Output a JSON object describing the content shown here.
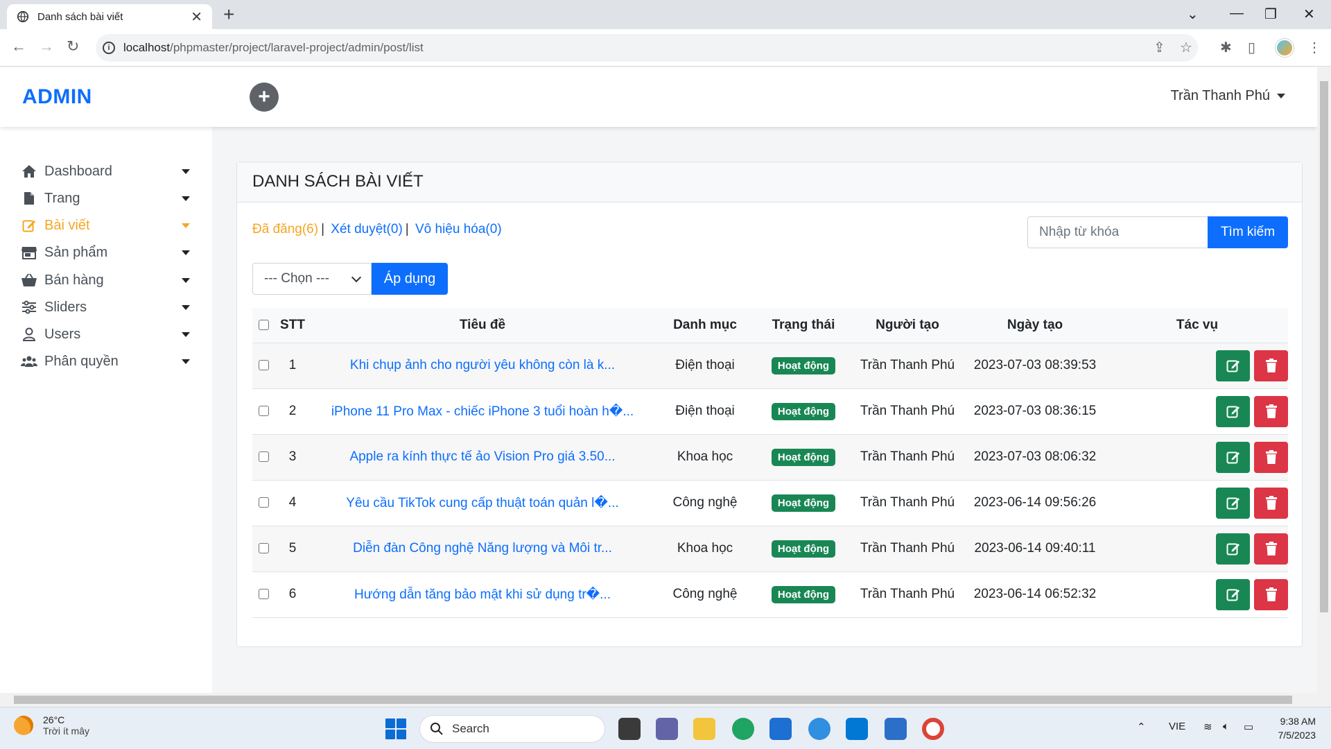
{
  "browser": {
    "tab_title": "Danh sách bài viết",
    "url_host": "localhost",
    "url_path": "/phpmaster/project/laravel-project/admin/post/list"
  },
  "header": {
    "brand": "ADMIN",
    "user_name": "Trần Thanh Phú"
  },
  "sidebar": {
    "items": [
      {
        "label": "Dashboard",
        "icon": "home-icon",
        "active": false
      },
      {
        "label": "Trang",
        "icon": "file-icon",
        "active": false
      },
      {
        "label": "Bài viết",
        "icon": "edit-icon",
        "active": true
      },
      {
        "label": "Sản phẩm",
        "icon": "store-icon",
        "active": false
      },
      {
        "label": "Bán hàng",
        "icon": "basket-icon",
        "active": false
      },
      {
        "label": "Sliders",
        "icon": "sliders-icon",
        "active": false
      },
      {
        "label": "Users",
        "icon": "user-icon",
        "active": false
      },
      {
        "label": "Phân quyền",
        "icon": "users-icon",
        "active": false
      }
    ],
    "active_color": "#f5a623"
  },
  "card": {
    "title": "DANH SÁCH BÀI VIẾT",
    "filters": [
      {
        "label": "Đã đăng(6)",
        "current": true
      },
      {
        "label": "Xét duyệt(0)",
        "current": false
      },
      {
        "label": "Vô hiệu hóa(0)",
        "current": false
      }
    ],
    "search_placeholder": "Nhập từ khóa",
    "search_button": "Tìm kiếm",
    "bulk_select": "--- Chọn ---",
    "apply_button": "Áp dụng"
  },
  "table": {
    "headers": [
      "STT",
      "Tiêu đề",
      "Danh mục",
      "Trạng thái",
      "Người tạo",
      "Ngày tạo",
      "Tác vụ"
    ],
    "rows": [
      {
        "stt": "1",
        "title": "Khi chụp ảnh cho người yêu không còn là k...",
        "category": "Điện thoại",
        "status": "Hoạt động",
        "author": "Trần Thanh Phú",
        "date": "2023-07-03 08:39:53"
      },
      {
        "stt": "2",
        "title": "iPhone 11 Pro Max - chiếc iPhone 3 tuổi hoàn h�...",
        "category": "Điện thoại",
        "status": "Hoạt động",
        "author": "Trần Thanh Phú",
        "date": "2023-07-03 08:36:15"
      },
      {
        "stt": "3",
        "title": "Apple ra kính thực tế ảo Vision Pro giá 3.50...",
        "category": "Khoa học",
        "status": "Hoạt động",
        "author": "Trần Thanh Phú",
        "date": "2023-07-03 08:06:32"
      },
      {
        "stt": "4",
        "title": "Yêu cầu TikTok cung cấp thuật toán quản l�...",
        "category": "Công nghệ",
        "status": "Hoạt động",
        "author": "Trần Thanh Phú",
        "date": "2023-06-14 09:56:26"
      },
      {
        "stt": "5",
        "title": "Diễn đàn Công nghệ Năng lượng và Môi tr...",
        "category": "Khoa học",
        "status": "Hoạt động",
        "author": "Trần Thanh Phú",
        "date": "2023-06-14 09:40:11"
      },
      {
        "stt": "6",
        "title": "Hướng dẫn tăng bảo mật khi sử dụng tr�...",
        "category": "Công nghệ",
        "status": "Hoạt động",
        "author": "Trần Thanh Phú",
        "date": "2023-06-14 06:52:32"
      }
    ]
  },
  "taskbar": {
    "weather_temp": "26°C",
    "weather_desc": "Trời ít mây",
    "search_label": "Search",
    "language": "VIE",
    "time": "9:38 AM",
    "date": "7/5/2023"
  }
}
